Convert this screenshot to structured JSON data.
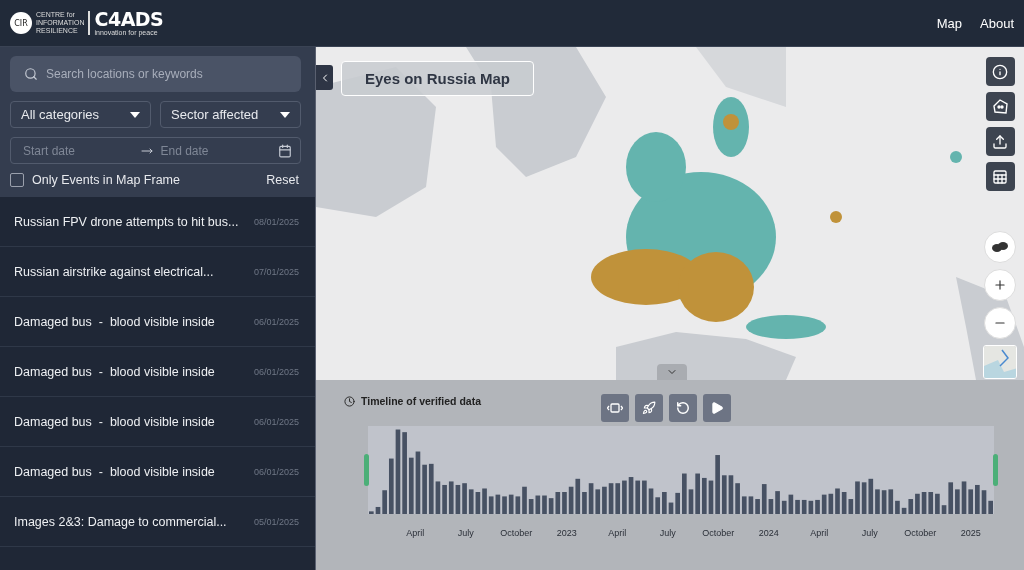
{
  "header": {
    "logo": {
      "badge": "CIR",
      "org_lines": [
        "CENTRE for",
        "INFORMATION",
        "RESILIENCE"
      ],
      "brand": "C4ADS",
      "tagline": "innovation for peace"
    },
    "nav": [
      "Map",
      "About"
    ]
  },
  "sidebar": {
    "search": {
      "placeholder": "Search locations or keywords"
    },
    "filters": [
      "All categories",
      "Sector affected"
    ],
    "date_range": {
      "start_placeholder": "Start date",
      "end_placeholder": "End date"
    },
    "map_frame_filter": {
      "label": "Only Events in Map Frame",
      "checked": false
    },
    "reset": "Reset",
    "events": [
      {
        "title": "Russian FPV drone attempts to hit bus...",
        "date": "08/01/2025"
      },
      {
        "title": "Russian airstrike against electrical...",
        "date": "07/01/2025"
      },
      {
        "title": "Damaged bus  -  blood visible inside",
        "date": "06/01/2025"
      },
      {
        "title": "Damaged bus  -  blood visible inside",
        "date": "06/01/2025"
      },
      {
        "title": "Damaged bus  -  blood visible inside",
        "date": "06/01/2025"
      },
      {
        "title": "Damaged bus  -  blood visible inside",
        "date": "06/01/2025"
      },
      {
        "title": "Images 2&3: Damage to commercial...",
        "date": "05/01/2025"
      }
    ]
  },
  "map": {
    "title": "Eyes on Russia Map"
  },
  "timeline": {
    "title": "Timeline of verified data",
    "axis_labels": [
      "April",
      "July",
      "October",
      "2023",
      "April",
      "July",
      "October",
      "2024",
      "April",
      "July",
      "October",
      "2025"
    ]
  }
}
